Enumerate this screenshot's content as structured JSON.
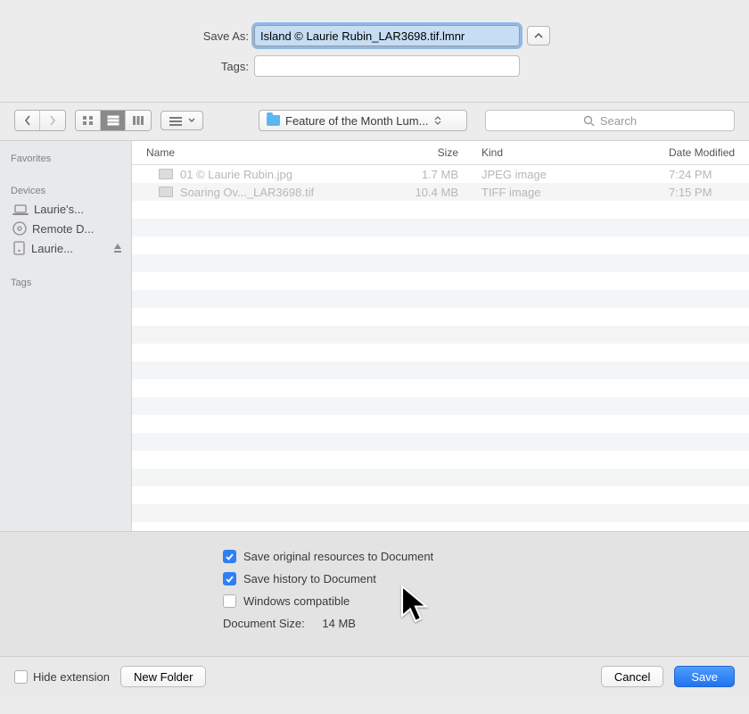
{
  "top": {
    "save_as_label": "Save As:",
    "save_as_value": "Island © Laurie Rubin_LAR3698.tif.lmnr",
    "tags_label": "Tags:",
    "tags_value": ""
  },
  "toolbar": {
    "folder_label": "Feature of the Month Lum...",
    "search_placeholder": "Search"
  },
  "sidebar": {
    "favorites_label": "Favorites",
    "devices_label": "Devices",
    "tags_label": "Tags",
    "devices": [
      {
        "label": "Laurie's...",
        "icon": "laptop"
      },
      {
        "label": "Remote D...",
        "icon": "disc"
      },
      {
        "label": "Laurie...",
        "icon": "drive",
        "eject": true
      }
    ]
  },
  "columns": {
    "name": "Name",
    "size": "Size",
    "kind": "Kind",
    "date": "Date Modified"
  },
  "files": [
    {
      "name": "01 © Laurie Rubin.jpg",
      "size": "1.7 MB",
      "kind": "JPEG image",
      "date": "7:24 PM"
    },
    {
      "name": "Soaring Ov..._LAR3698.tif",
      "size": "10.4 MB",
      "kind": "TIFF image",
      "date": "7:15 PM"
    }
  ],
  "options": {
    "save_resources": {
      "label": "Save original resources to Document",
      "checked": true
    },
    "save_history": {
      "label": "Save history to Document",
      "checked": true
    },
    "windows_compat": {
      "label": "Windows compatible",
      "checked": false
    },
    "doc_size_label": "Document Size:",
    "doc_size_value": "14 MB"
  },
  "footer": {
    "hide_extension": "Hide extension",
    "new_folder": "New Folder",
    "cancel": "Cancel",
    "save": "Save"
  }
}
